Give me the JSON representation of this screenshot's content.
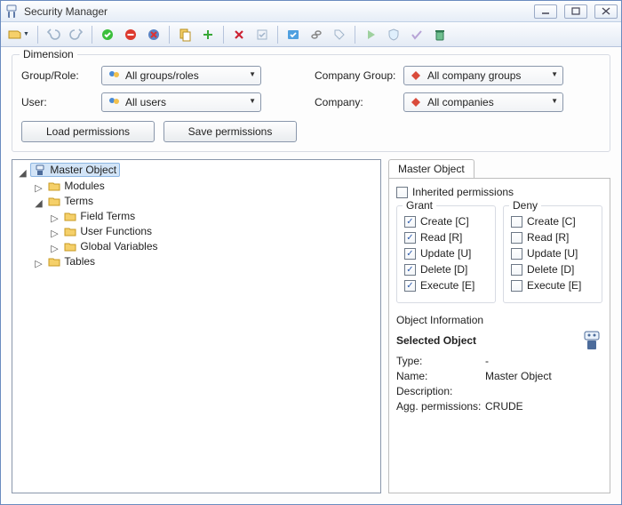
{
  "window": {
    "title": "Security Manager"
  },
  "dimension": {
    "legend": "Dimension",
    "labels": {
      "group_role": "Group/Role:",
      "user": "User:",
      "company_group": "Company Group:",
      "company": "Company:"
    },
    "values": {
      "group_role": "All groups/roles",
      "user": "All users",
      "company_group": "All company groups",
      "company": "All companies"
    },
    "buttons": {
      "load": "Load permissions",
      "save": "Save permissions"
    }
  },
  "tree": {
    "root": "Master Object",
    "nodes": {
      "modules": "Modules",
      "terms": "Terms",
      "field_terms": "Field Terms",
      "user_functions": "User Functions",
      "global_variables": "Global Variables",
      "tables": "Tables"
    }
  },
  "tab": {
    "label": "Master Object",
    "inherited": "Inherited permissions"
  },
  "grant": {
    "legend": "Grant",
    "items": [
      "Create [C]",
      "Read [R]",
      "Update [U]",
      "Delete [D]",
      "Execute [E]"
    ]
  },
  "deny": {
    "legend": "Deny",
    "items": [
      "Create [C]",
      "Read [R]",
      "Update [U]",
      "Delete [D]",
      "Execute [E]"
    ]
  },
  "info": {
    "section": "Object Information",
    "selected": "Selected Object",
    "labels": {
      "type": "Type:",
      "name": "Name:",
      "description": "Description:",
      "agg": "Agg. permissions:"
    },
    "values": {
      "type": "-",
      "name": "Master Object",
      "description": "",
      "agg": "CRUDE"
    }
  }
}
